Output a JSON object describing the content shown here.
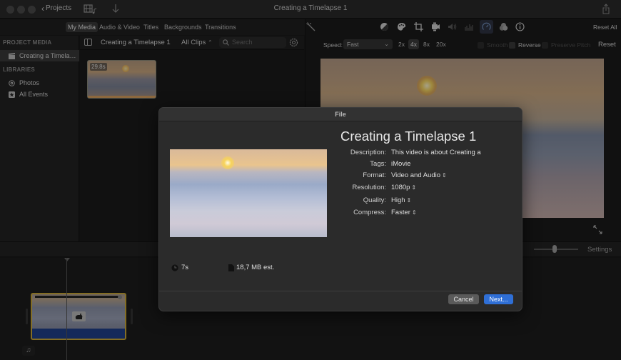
{
  "window": {
    "title": "Creating a Timelapse 1",
    "back_label": "Projects",
    "icons": [
      "media-toggle-icon",
      "import-download-icon",
      "share-icon"
    ]
  },
  "browser_tabs": [
    {
      "label": "My Media",
      "active": true
    },
    {
      "label": "Audio & Video",
      "active": false
    },
    {
      "label": "Titles",
      "active": false
    },
    {
      "label": "Backgrounds",
      "active": false
    },
    {
      "label": "Transitions",
      "active": false
    }
  ],
  "sidebar": {
    "project_media_header": "PROJECT MEDIA",
    "project_item": "Creating a Timela…",
    "libraries_header": "LIBRARIES",
    "library_items": [
      {
        "label": "Photos",
        "icon": "photos-flower-icon"
      },
      {
        "label": "All Events",
        "icon": "star-icon"
      }
    ]
  },
  "browser": {
    "title": "Creating a Timelapse 1",
    "filter": "All Clips",
    "search_placeholder": "Search",
    "clips": [
      {
        "duration": "29.8s"
      }
    ]
  },
  "viewer": {
    "tools": [
      "color-balance-icon",
      "color-correction-icon",
      "crop-icon",
      "stabilization-icon",
      "volume-icon",
      "noise-reduction-icon",
      "speed-icon",
      "clip-filter-icon",
      "info-icon"
    ],
    "active_tool": "speed-icon",
    "reset_all_label": "Reset All",
    "speed_label": "Speed:",
    "speed_value": "Fast",
    "rates": [
      {
        "label": "2x",
        "active": false
      },
      {
        "label": "4x",
        "active": true
      },
      {
        "label": "8x",
        "active": false
      },
      {
        "label": "20x",
        "active": false
      }
    ],
    "checkboxes": [
      {
        "label": "Smooth",
        "checked": false,
        "enabled": false
      },
      {
        "label": "Reverse",
        "checked": false,
        "enabled": true
      },
      {
        "label": "Preserve Pitch",
        "checked": false,
        "enabled": false
      }
    ],
    "reset_label": "Reset"
  },
  "timeline": {
    "settings_label": "Settings",
    "zoom_level": 0.47
  },
  "dialog": {
    "title": "File",
    "project_title": "Creating a Timelapse 1",
    "fields": [
      {
        "label": "Description:",
        "value": "This video is about Creating a",
        "stepper": false
      },
      {
        "label": "Tags:",
        "value": "iMovie",
        "stepper": false
      },
      {
        "label": "Format:",
        "value": "Video and Audio",
        "stepper": true
      },
      {
        "label": "Resolution:",
        "value": "1080p",
        "stepper": true
      },
      {
        "label": "Quality:",
        "value": "High",
        "stepper": true
      },
      {
        "label": "Compress:",
        "value": "Faster",
        "stepper": true
      }
    ],
    "duration": "7s",
    "size_estimate": "18,7 MB est.",
    "cancel_label": "Cancel",
    "next_label": "Next...",
    "accent_color": "#2f6fd6"
  }
}
